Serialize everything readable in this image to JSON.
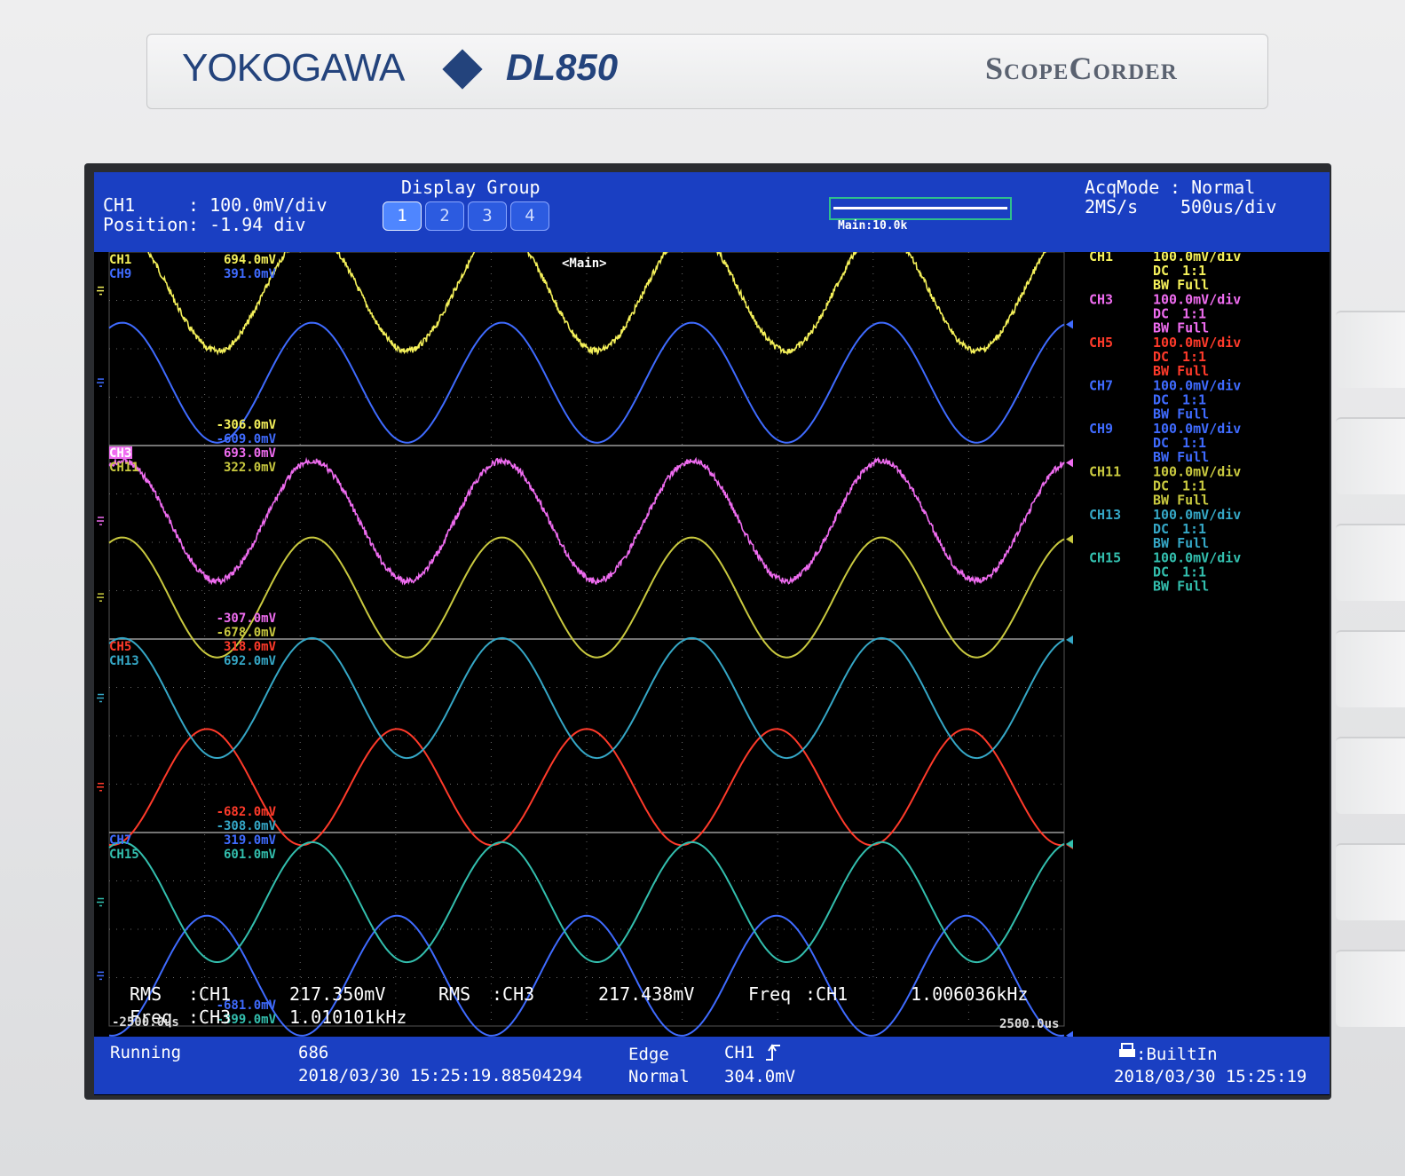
{
  "device": {
    "brand": "YOKOGAWA",
    "model": "DL850",
    "product": "ScopeCorder"
  },
  "header": {
    "channel": "CH1",
    "channel_scale": ": 100.0mV/div",
    "position_label": "Position",
    "position_value": ": -1.94 div",
    "display_group_label": "Display Group",
    "groups": [
      "1",
      "2",
      "3",
      "4"
    ],
    "active_group": "1",
    "zoom_label": "Main:10.0k",
    "acq_mode_label": "AcqMode",
    "acq_mode_value": ": Normal",
    "sample_rate": "2MS/s",
    "timebase": "500us/div"
  },
  "trigger_marker": "T",
  "main_marker": "<Main>",
  "colors": {
    "CH1": "#f4f05a",
    "CH9": "#3f6bff",
    "CH3": "#ef6cf0",
    "CH11": "#c9c93f",
    "CH5": "#ff3a2a",
    "CH13": "#35a7c6",
    "CH7": "#3f6bff",
    "CH15": "#33bfae",
    "grid": "#6a6a6a",
    "divider": "#9a9a9a"
  },
  "zones": [
    {
      "labels": [
        {
          "ch": "CH1",
          "max": "694.0mV",
          "min": "-306.0mV"
        },
        {
          "ch": "CH9",
          "max": "391.0mV",
          "min": "-609.0mV"
        }
      ]
    },
    {
      "labels": [
        {
          "ch": "CH3",
          "max": "693.0mV",
          "min": "-307.0mV"
        },
        {
          "ch": "CH11",
          "max": "322.0mV",
          "min": "-678.0mV"
        }
      ]
    },
    {
      "labels": [
        {
          "ch": "CH5",
          "max": "318.0mV",
          "min": "-682.0mV"
        },
        {
          "ch": "CH13",
          "max": "692.0mV",
          "min": "-308.0mV"
        }
      ]
    },
    {
      "labels": [
        {
          "ch": "CH7",
          "max": "319.0mV",
          "min": "-681.0mV"
        },
        {
          "ch": "CH15",
          "max": "601.0mV",
          "min": "-399.0mV"
        }
      ]
    }
  ],
  "traces": [
    {
      "ch": "CH9",
      "zone": 0,
      "center": -0.175,
      "amplitude": 0.31,
      "phase_ms": 0.55,
      "noisy": false
    },
    {
      "ch": "CH1",
      "zone": 0,
      "center": 0.3,
      "amplitude": 0.31,
      "phase_ms": 0.55,
      "noisy": true
    },
    {
      "ch": "CH11",
      "zone": 1,
      "center": -0.285,
      "amplitude": 0.31,
      "phase_ms": 0.55,
      "noisy": false
    },
    {
      "ch": "CH3",
      "zone": 1,
      "center": 0.11,
      "amplitude": 0.31,
      "phase_ms": 0.55,
      "noisy": true
    },
    {
      "ch": "CH5",
      "zone": 2,
      "center": -0.265,
      "amplitude": 0.3,
      "phase_ms": 0.0,
      "noisy": false
    },
    {
      "ch": "CH13",
      "zone": 2,
      "center": 0.195,
      "amplitude": 0.31,
      "phase_ms": 0.55,
      "noisy": false
    },
    {
      "ch": "CH7",
      "zone": 3,
      "center": -0.24,
      "amplitude": 0.31,
      "phase_ms": 0.0,
      "noisy": false
    },
    {
      "ch": "CH15",
      "zone": 3,
      "center": 0.14,
      "amplitude": 0.31,
      "phase_ms": 0.55,
      "noisy": false
    }
  ],
  "time_axis": {
    "start": "-2500.0us",
    "end": "2500.0us",
    "freq_khz": 1.006
  },
  "channel_settings": [
    {
      "ch": "CH1",
      "scale": "100.0mV/div",
      "coupling": "DC",
      "probe": "1:1",
      "bw": "BW Full"
    },
    {
      "ch": "CH3",
      "scale": "100.0mV/div",
      "coupling": "DC",
      "probe": "1:1",
      "bw": "BW Full"
    },
    {
      "ch": "CH5",
      "scale": "100.0mV/div",
      "coupling": "DC",
      "probe": "1:1",
      "bw": "BW Full"
    },
    {
      "ch": "CH7",
      "scale": "100.0mV/div",
      "coupling": "DC",
      "probe": "1:1",
      "bw": "BW Full"
    },
    {
      "ch": "CH9",
      "scale": "100.0mV/div",
      "coupling": "DC",
      "probe": "1:1",
      "bw": "BW Full"
    },
    {
      "ch": "CH11",
      "scale": "100.0mV/div",
      "coupling": "DC",
      "probe": "1:1",
      "bw": "BW Full"
    },
    {
      "ch": "CH13",
      "scale": "100.0mV/div",
      "coupling": "DC",
      "probe": "1:1",
      "bw": "BW Full"
    },
    {
      "ch": "CH15",
      "scale": "100.0mV/div",
      "coupling": "DC",
      "probe": "1:1",
      "bw": "BW Full"
    }
  ],
  "measurements": [
    {
      "type": "RMS",
      "ch": ":CH1",
      "value": "217.350mV"
    },
    {
      "type": "RMS",
      "ch": ":CH3",
      "value": "217.438mV"
    },
    {
      "type": "Freq",
      "ch": ":CH1",
      "value": "1.006036kHz"
    },
    {
      "type": "Freq",
      "ch": ":CH3",
      "value": "1.010101kHz"
    }
  ],
  "status": {
    "state": "Running",
    "count": "686",
    "trigger_time": "2018/03/30 15:25:19.88504294",
    "trigger_type": "Edge",
    "trigger_mode": "Normal",
    "trigger_source": "CH1",
    "trigger_slope_icon": "rising-edge-icon",
    "trigger_level": "304.0mV",
    "storage_icon": "printer-icon",
    "storage": ":BuiltIn",
    "clock": "2018/03/30 15:25:19"
  }
}
